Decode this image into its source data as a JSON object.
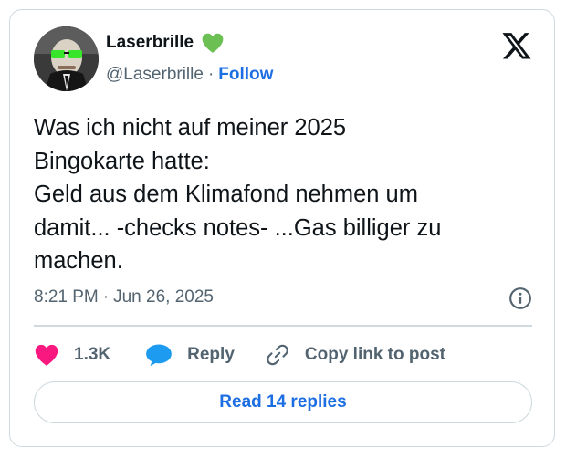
{
  "author": {
    "display_name": "Laserbrille",
    "name_emoji_icon": "green-heart-icon",
    "handle": "@Laserbrille",
    "separator": "·",
    "follow_label": "Follow"
  },
  "tweet": {
    "lines": [
      "Was ich nicht auf meiner 2025",
      "Bingokarte hatte:",
      "Geld aus dem Klimafond nehmen um",
      "damit... -checks notes- ...Gas billiger zu",
      "machen."
    ],
    "time": "8:21 PM",
    "separator": "·",
    "date": "Jun 26, 2025"
  },
  "actions": {
    "like_count": "1.3K",
    "reply_label": "Reply",
    "copy_label": "Copy link to post"
  },
  "read_replies_label": "Read 14 replies",
  "colors": {
    "accent": "#1d6ee3",
    "like": "#f91880",
    "reply_bubble": "#1d9bf0",
    "border": "#cfd9de",
    "muted": "#536471",
    "text": "#0f1419",
    "green_heart": "#6cbf52"
  }
}
